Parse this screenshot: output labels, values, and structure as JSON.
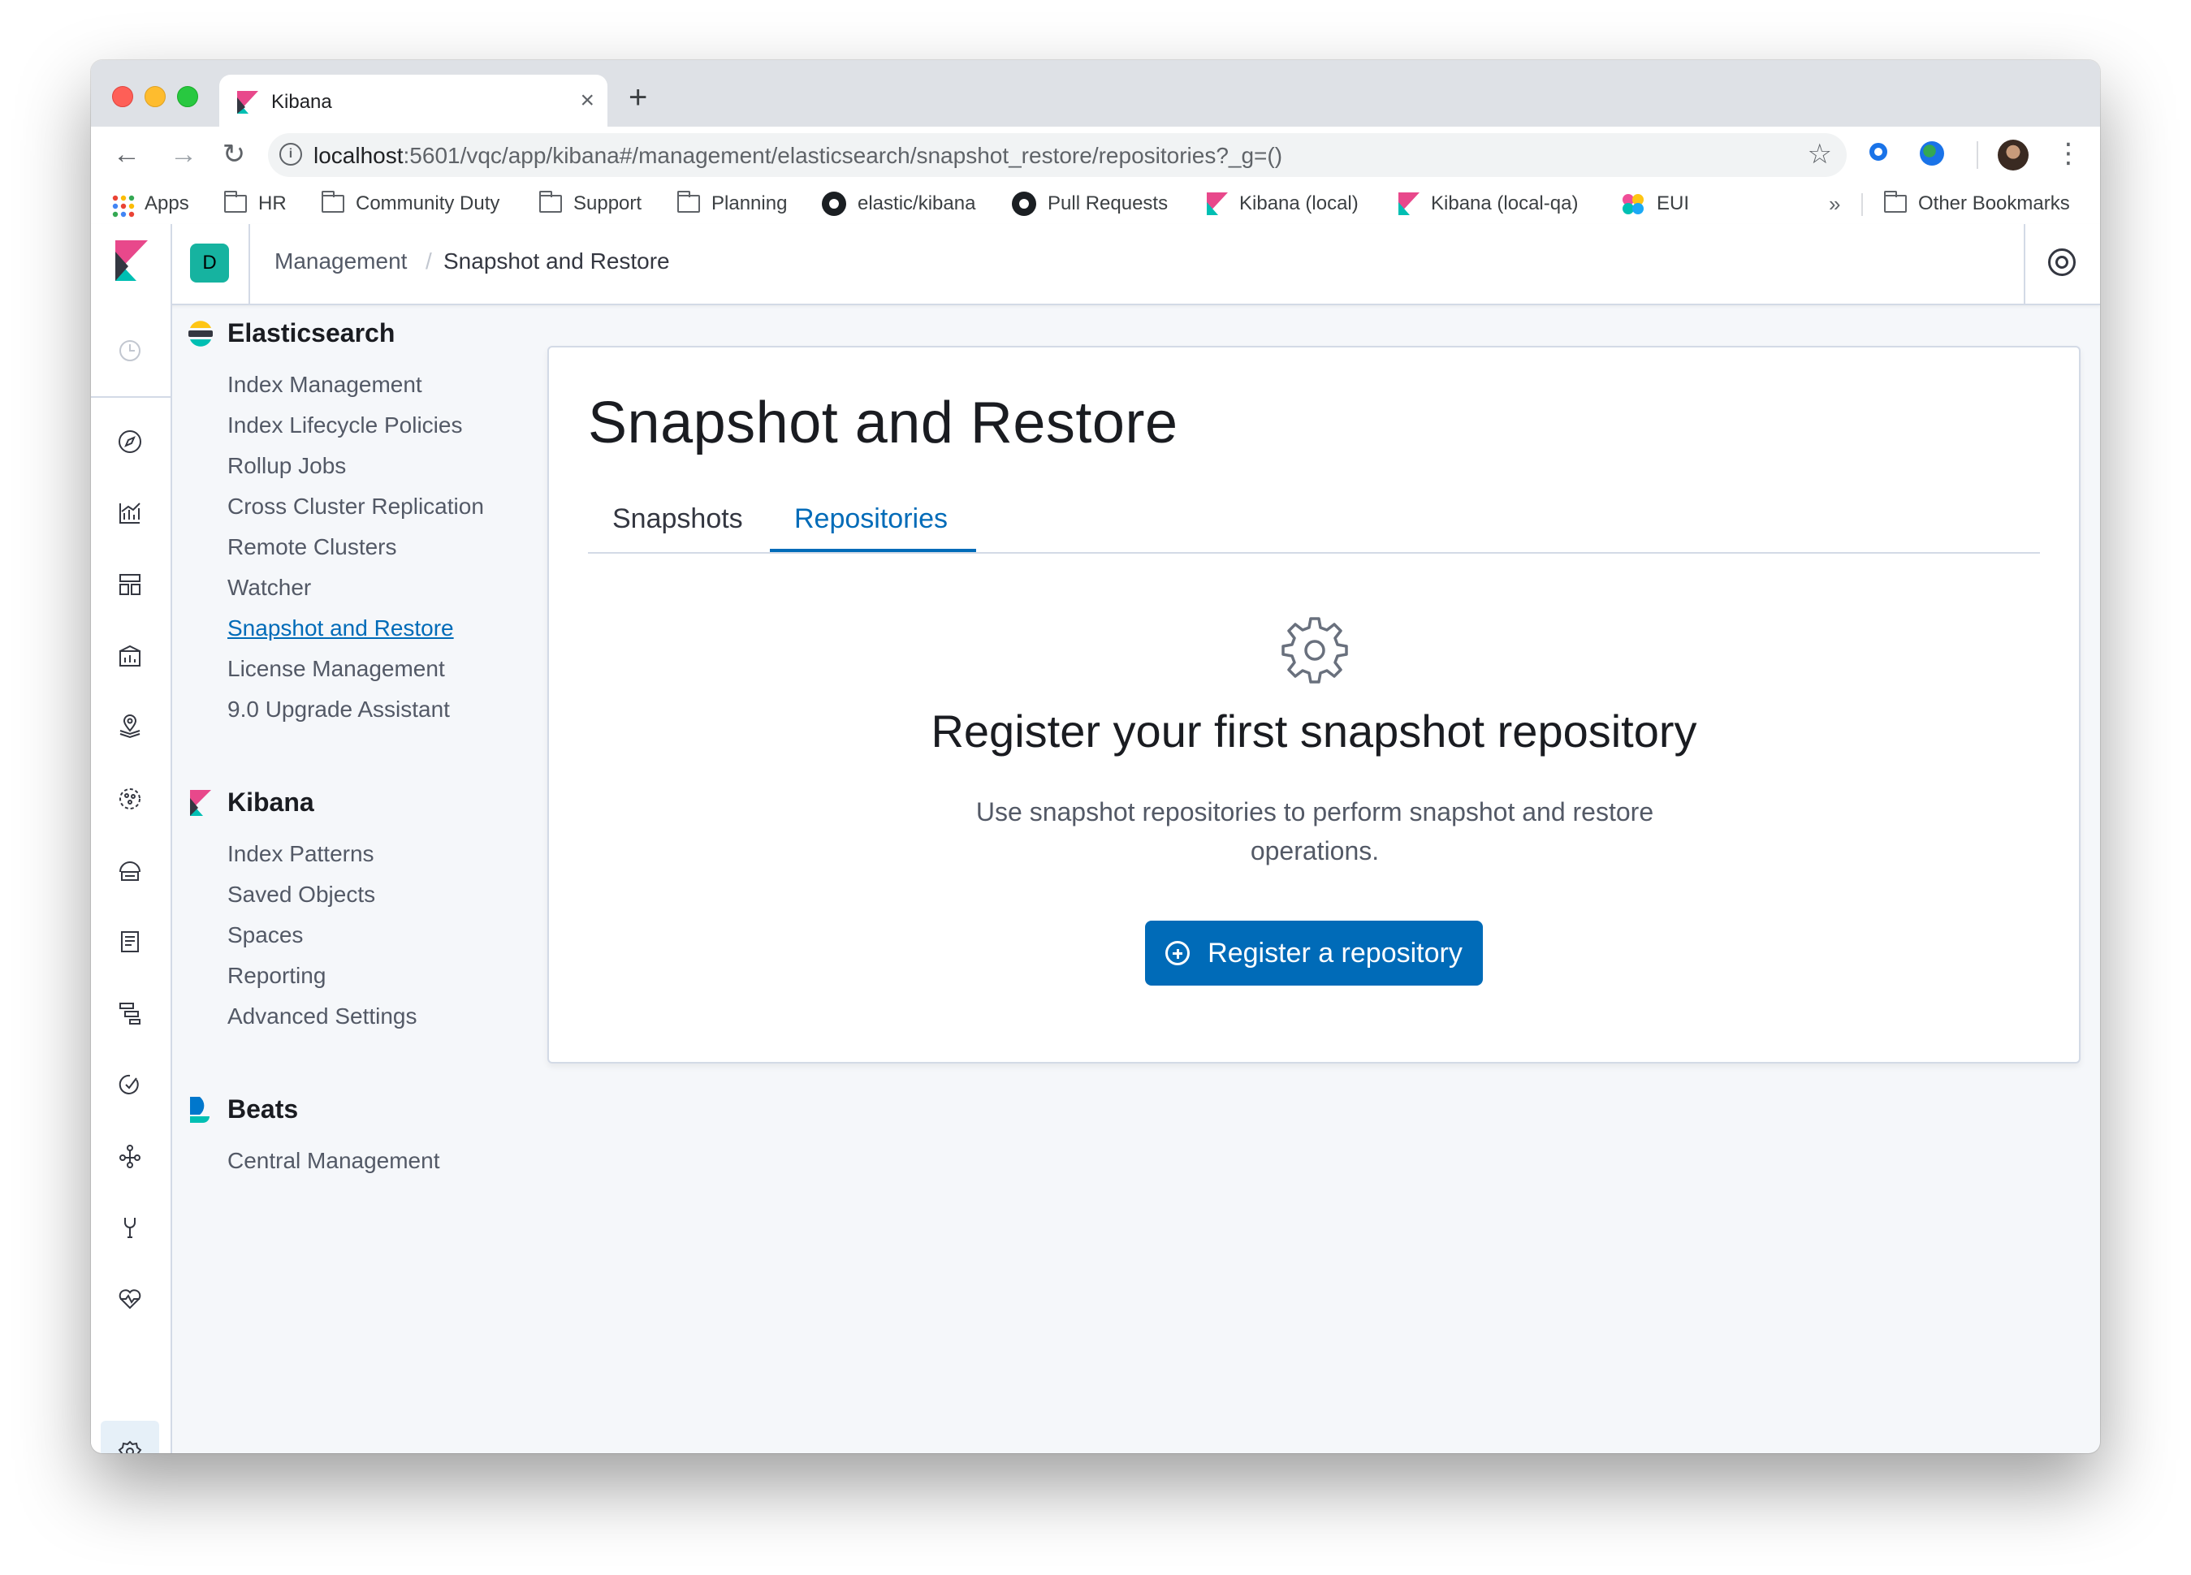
{
  "browser": {
    "tab_title": "Kibana",
    "tab_close": "×",
    "new_tab": "+",
    "url_host": "localhost",
    "url_path": ":5601/vqc/app/kibana#/management/elasticsearch/snapshot_restore/repositories?_g=()",
    "back": "←",
    "forward": "→",
    "reload": "↻",
    "star": "☆",
    "menu": "⋮",
    "bookmarks": [
      {
        "label": "Apps",
        "icon": "apps-grid-icon"
      },
      {
        "label": "HR",
        "icon": "folder-icon"
      },
      {
        "label": "Community Duty",
        "icon": "folder-icon"
      },
      {
        "label": "Support",
        "icon": "folder-icon"
      },
      {
        "label": "Planning",
        "icon": "folder-icon"
      },
      {
        "label": "elastic/kibana",
        "icon": "github-icon"
      },
      {
        "label": "Pull Requests",
        "icon": "github-icon"
      },
      {
        "label": "Kibana (local)",
        "icon": "kibana-icon"
      },
      {
        "label": "Kibana (local-qa)",
        "icon": "kibana-icon"
      },
      {
        "label": "EUI",
        "icon": "eui-icon"
      }
    ],
    "bookmarks_more": "»",
    "other_bookmarks": "Other Bookmarks"
  },
  "header": {
    "space_initial": "D",
    "breadcrumbs": [
      "Management",
      "Snapshot and Restore"
    ],
    "breadcrumb_separator": "/"
  },
  "sidebar": {
    "sections": [
      {
        "title": "Elasticsearch",
        "items": [
          "Index Management",
          "Index Lifecycle Policies",
          "Rollup Jobs",
          "Cross Cluster Replication",
          "Remote Clusters",
          "Watcher",
          "Snapshot and Restore",
          "License Management",
          "9.0 Upgrade Assistant"
        ]
      },
      {
        "title": "Kibana",
        "items": [
          "Index Patterns",
          "Saved Objects",
          "Spaces",
          "Reporting",
          "Advanced Settings"
        ]
      },
      {
        "title": "Beats",
        "items": [
          "Central Management"
        ]
      }
    ],
    "active_item": "Snapshot and Restore"
  },
  "main": {
    "title": "Snapshot and Restore",
    "tabs": [
      "Snapshots",
      "Repositories"
    ],
    "selected_tab": "Repositories",
    "empty_state": {
      "icon": "gear-icon",
      "title": "Register your first snapshot repository",
      "body": "Use snapshot repositories to perform snapshot and restore operations.",
      "button_label": "Register a repository"
    }
  },
  "colors": {
    "accent": "#006bb8",
    "space_avatar": "#16b3a0",
    "kibana_pink": "#e8488b",
    "kibana_teal": "#00bfb3"
  }
}
